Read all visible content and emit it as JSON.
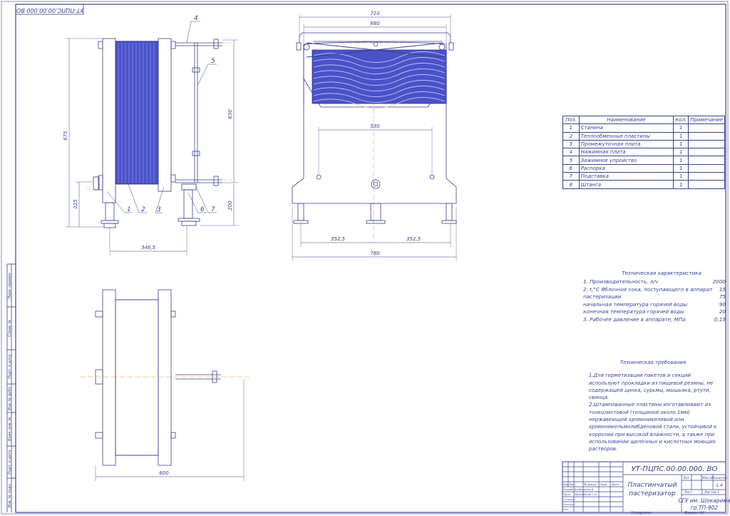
{
  "stamp_top": "УТ-ПЦПС.00.00.000 ВО",
  "dims": {
    "side_675": "675",
    "side_650": "650",
    "side_225": "225",
    "side_200": "200",
    "side_3465": "346,5",
    "front_710": "710",
    "front_680": "680",
    "front_530": "530",
    "front_3525a": "352,5",
    "front_3525b": "352,5",
    "front_780": "780",
    "top_600": "600"
  },
  "callouts": [
    "1",
    "2",
    "3",
    "4",
    "5",
    "6",
    "7"
  ],
  "spec": {
    "headers": [
      "Поз.",
      "Наименование",
      "Кол.",
      "Примечание"
    ],
    "rows": [
      {
        "pos": "1",
        "name": "Станина",
        "qty": "1",
        "note": ""
      },
      {
        "pos": "2",
        "name": "Теплообменные пластины",
        "qty": "1",
        "note": ""
      },
      {
        "pos": "3",
        "name": "Промежуточная плита",
        "qty": "1",
        "note": ""
      },
      {
        "pos": "4",
        "name": "Нажимная плита",
        "qty": "1",
        "note": ""
      },
      {
        "pos": "5",
        "name": "Зажимное упройство",
        "qty": "1",
        "note": ""
      },
      {
        "pos": "6",
        "name": "Распорка",
        "qty": "1",
        "note": ""
      },
      {
        "pos": "7",
        "name": "Подставка",
        "qty": "1",
        "note": ""
      },
      {
        "pos": "8",
        "name": "Штанга",
        "qty": "1",
        "note": ""
      }
    ]
  },
  "tech": {
    "title": "Техническая характеристика",
    "rows": [
      {
        "label": "1. Производительность, л/ч",
        "value": "2000"
      },
      {
        "label": "2. t,°С  Яблочное сока, поступающего в аппарат",
        "value": "15"
      },
      {
        "label": "      пастеризации",
        "value": "75"
      },
      {
        "label": "      начальная температура горячей воды",
        "value": "90"
      },
      {
        "label": "      конечная температура горячей воды",
        "value": "20"
      },
      {
        "label": "3. Рабочее давление в аппарате, МПа",
        "value": "0,15"
      }
    ]
  },
  "requirements": {
    "title": "Техническая требования",
    "paragraphs": [
      "1.Для герметизации пакетов и секций используют прокладки из пищевой резины, не содержащей цинка, сурьмы, мышьяка, ртути, свинца.",
      "2.Штампованные пластины изготавливают из тонколистовой (толщиной около 1мм) нержавеющей хромоникелевой или хромоникельмолибденовой стали, устойчивой к коррозии при высокой влажности, а также при использовании щелочных и кислотных моющих растворов."
    ]
  },
  "title_block": {
    "code": "УТ-ПЦПС.00.00.000. ВО",
    "name_line1": "Пластинчатый",
    "name_line2": "пастеризатор",
    "lit": "Лит.",
    "mass": "Масса",
    "scale": "Масштаб",
    "scale_value": "1:4",
    "sheet": "Лист",
    "sheets": "Листов  1",
    "org_line1": "СГУ им. Шокарима",
    "org_line2": "гр.ТП-902",
    "cols": [
      "Изм",
      "Лист",
      "№ докум.",
      "Подп.",
      "Дата"
    ],
    "roles": [
      "Разраб.",
      "Пров.",
      "Т.контр.",
      "Н.контр.",
      "Утв."
    ],
    "names": [
      "Бекболатов Д.",
      "Махамбеткв С.К."
    ],
    "copied": "Копировал",
    "format": "Формат  А1"
  },
  "left_strip": [
    "Перв. примен.",
    "Справ. №",
    "Подп. и дата",
    "Инв. № дубл.",
    "Взам. инв. №",
    "Подп. и дата",
    "Инв. № подл."
  ]
}
